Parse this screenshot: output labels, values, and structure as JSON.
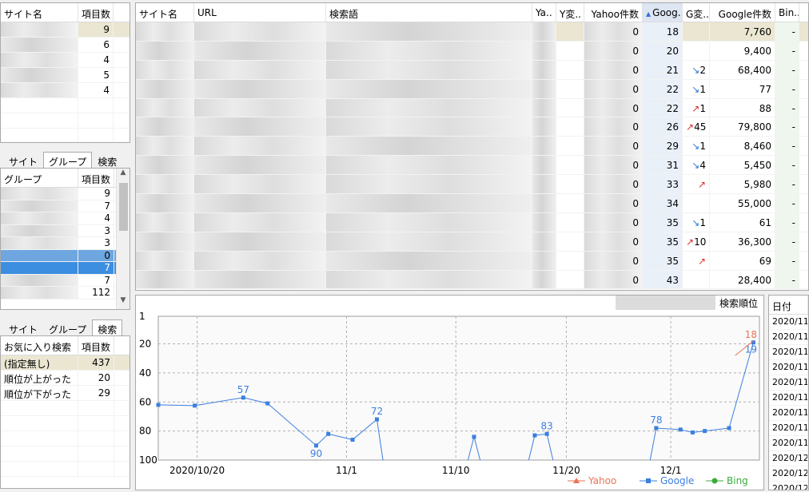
{
  "site_panel": {
    "col_name": "サイト名",
    "col_count": "項目数",
    "counts": [
      "9",
      "6",
      "4",
      "5",
      "4"
    ]
  },
  "group_panel": {
    "tabs": [
      "サイト",
      "グループ",
      "検索"
    ],
    "col_name": "グループ",
    "col_count": "項目数",
    "counts": [
      "9",
      "7",
      "4",
      "3",
      "3",
      "0",
      "7",
      "7",
      "112"
    ]
  },
  "search_panel": {
    "tabs": [
      "サイト",
      "グループ",
      "検索"
    ],
    "col_name": "お気に入り検索",
    "col_count": "項目数",
    "rows": [
      {
        "name": "(指定無し)",
        "count": "437"
      },
      {
        "name": "順位が上がった",
        "count": "20"
      },
      {
        "name": "順位が下がった",
        "count": "29"
      }
    ]
  },
  "main_table": {
    "headers": [
      "サイト名",
      "URL",
      "検索語",
      "Ya..",
      "Y変..",
      "Yahoo件数",
      "Goog..",
      "G変..",
      "Google件数",
      "Bin.."
    ],
    "rows": [
      {
        "yahoo": "0",
        "goog": "18",
        "gchg": "",
        "gdir": "",
        "gcount": "7,760",
        "bing": "-"
      },
      {
        "yahoo": "0",
        "goog": "20",
        "gchg": "",
        "gdir": "",
        "gcount": "9,400",
        "bing": "-"
      },
      {
        "yahoo": "0",
        "goog": "21",
        "gchg": "2",
        "gdir": "down",
        "gcount": "68,400",
        "bing": "-"
      },
      {
        "yahoo": "0",
        "goog": "22",
        "gchg": "1",
        "gdir": "down",
        "gcount": "77",
        "bing": "-"
      },
      {
        "yahoo": "0",
        "goog": "22",
        "gchg": "1",
        "gdir": "up",
        "gcount": "88",
        "bing": "-"
      },
      {
        "yahoo": "0",
        "goog": "26",
        "gchg": "45",
        "gdir": "up",
        "gcount": "79,800",
        "bing": "-"
      },
      {
        "yahoo": "0",
        "goog": "29",
        "gchg": "1",
        "gdir": "down",
        "gcount": "8,460",
        "bing": "-"
      },
      {
        "yahoo": "0",
        "goog": "31",
        "gchg": "4",
        "gdir": "down",
        "gcount": "5,450",
        "bing": "-"
      },
      {
        "yahoo": "0",
        "goog": "33",
        "gchg": "",
        "gdir": "up",
        "gcount": "5,980",
        "bing": "-"
      },
      {
        "yahoo": "0",
        "goog": "34",
        "gchg": "",
        "gdir": "",
        "gcount": "55,000",
        "bing": "-"
      },
      {
        "yahoo": "0",
        "goog": "35",
        "gchg": "1",
        "gdir": "down",
        "gcount": "61",
        "bing": "-"
      },
      {
        "yahoo": "0",
        "goog": "35",
        "gchg": "10",
        "gdir": "up",
        "gcount": "36,300",
        "bing": "-"
      },
      {
        "yahoo": "0",
        "goog": "35",
        "gchg": "",
        "gdir": "up",
        "gcount": "69",
        "bing": "-"
      },
      {
        "yahoo": "0",
        "goog": "43",
        "gchg": "",
        "gdir": "",
        "gcount": "28,400",
        "bing": "-"
      }
    ]
  },
  "date_panel": {
    "header": "日付",
    "dates": [
      "2020/11",
      "2020/11",
      "2020/11",
      "2020/11",
      "2020/11",
      "2020/11",
      "2020/11",
      "2020/11",
      "2020/11",
      "2020/12",
      "2020/12",
      "2020/12"
    ]
  },
  "chart_data": {
    "type": "line",
    "title": "検索順位",
    "ylim": [
      1,
      100
    ],
    "y_reversed": true,
    "y_ticks": [
      "1",
      "20",
      "40",
      "60",
      "80",
      "100"
    ],
    "x_ticks": [
      "2020/10/20",
      "11/1",
      "11/10",
      "11/20",
      "12/1"
    ],
    "grid": true,
    "legend": [
      "Yahoo",
      "Google",
      "Bing"
    ],
    "colors": {
      "yahoo": "#e8735a",
      "google": "#3b7fe0",
      "bing": "#3cab3c"
    },
    "series": [
      {
        "name": "Google",
        "segments": [
          [
            [
              0,
              62
            ],
            [
              3,
              62.5
            ],
            [
              7,
              57
            ],
            [
              9,
              61
            ],
            [
              13,
              90
            ],
            [
              14,
              82
            ],
            [
              16,
              86
            ],
            [
              18,
              72
            ],
            [
              18.5,
              100
            ]
          ],
          [
            [
              25.5,
              100
            ],
            [
              26,
              84
            ],
            [
              26.5,
              100
            ]
          ],
          [
            [
              30.5,
              100
            ],
            [
              31,
              83
            ],
            [
              32,
              82
            ],
            [
              32.5,
              100
            ]
          ],
          [
            [
              40.5,
              100
            ],
            [
              41,
              78
            ],
            [
              43,
              79
            ],
            [
              44,
              81
            ],
            [
              45,
              80
            ],
            [
              47,
              78
            ],
            [
              49,
              19
            ]
          ]
        ],
        "labels": [
          {
            "x": 7,
            "y": 57,
            "text": "57"
          },
          {
            "x": 13,
            "y": 90,
            "text": "90"
          },
          {
            "x": 18,
            "y": 72,
            "text": "72"
          },
          {
            "x": 32,
            "y": 82,
            "text": "83"
          },
          {
            "x": 41,
            "y": 78,
            "text": "78"
          },
          {
            "x": 49,
            "y": 19,
            "text": "19"
          }
        ]
      },
      {
        "name": "Yahoo",
        "segments": [
          [
            [
              47.5,
              28
            ],
            [
              49,
              18
            ]
          ]
        ],
        "labels": [
          {
            "x": 49,
            "y": 18,
            "text": "18"
          }
        ]
      }
    ]
  }
}
